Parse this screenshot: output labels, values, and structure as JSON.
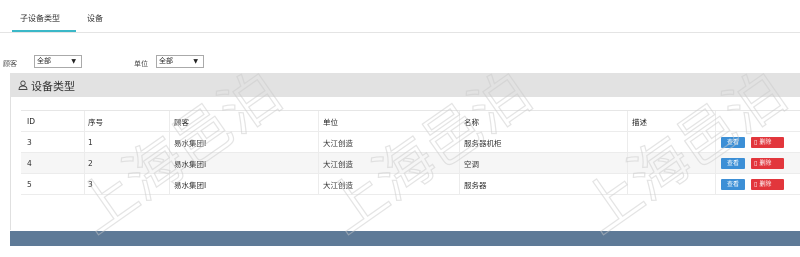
{
  "tabs": [
    {
      "label": "子设备类型",
      "active": true
    },
    {
      "label": "设备",
      "active": false
    }
  ],
  "filters": {
    "customer_label": "顾客",
    "customer_value": "全部",
    "unit_label": "单位",
    "unit_value": "全部",
    "arrow": "▼"
  },
  "panel": {
    "title": "设备类型"
  },
  "table": {
    "headers": [
      "ID",
      "序号",
      "顾客",
      "单位",
      "名称",
      "描述"
    ],
    "rows": [
      {
        "id": "3",
        "seq": "1",
        "customer": "易水集团I",
        "unit": "大江创造",
        "name": "服务器机柜",
        "desc": ""
      },
      {
        "id": "4",
        "seq": "2",
        "customer": "易水集团I",
        "unit": "大江创造",
        "name": "空调",
        "desc": ""
      },
      {
        "id": "5",
        "seq": "3",
        "customer": "易水集团I",
        "unit": "大江创造",
        "name": "服务器",
        "desc": ""
      }
    ],
    "view_label": "查看",
    "delete_label": "删除"
  },
  "watermark": "上海邑泊",
  "colors": {
    "accent": "#3bb8c8",
    "view_button": "#3c8fd6",
    "delete_button": "#e2363c",
    "footer": "#5e7a97"
  }
}
